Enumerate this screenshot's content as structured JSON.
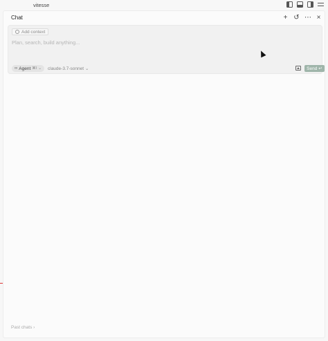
{
  "window": {
    "title": "vitesse"
  },
  "chat": {
    "title": "Chat",
    "icons": {
      "new": "plus-icon",
      "history": "history-icon",
      "more": "more-icon",
      "close": "close-icon"
    }
  },
  "composer": {
    "add_context_label": "Add context",
    "placeholder": "Plan, search, build anything...",
    "agent_label": "Agent",
    "agent_shortcut": "⌘I",
    "model_label": "claude-3.7-sonnet",
    "send_label": "Send"
  },
  "footer": {
    "past_chats_label": "Past chats"
  },
  "colors": {
    "send_bg": "#9fb5aa",
    "panel_bg": "#fbfbfb",
    "composer_bg": "#f1f1f1"
  }
}
